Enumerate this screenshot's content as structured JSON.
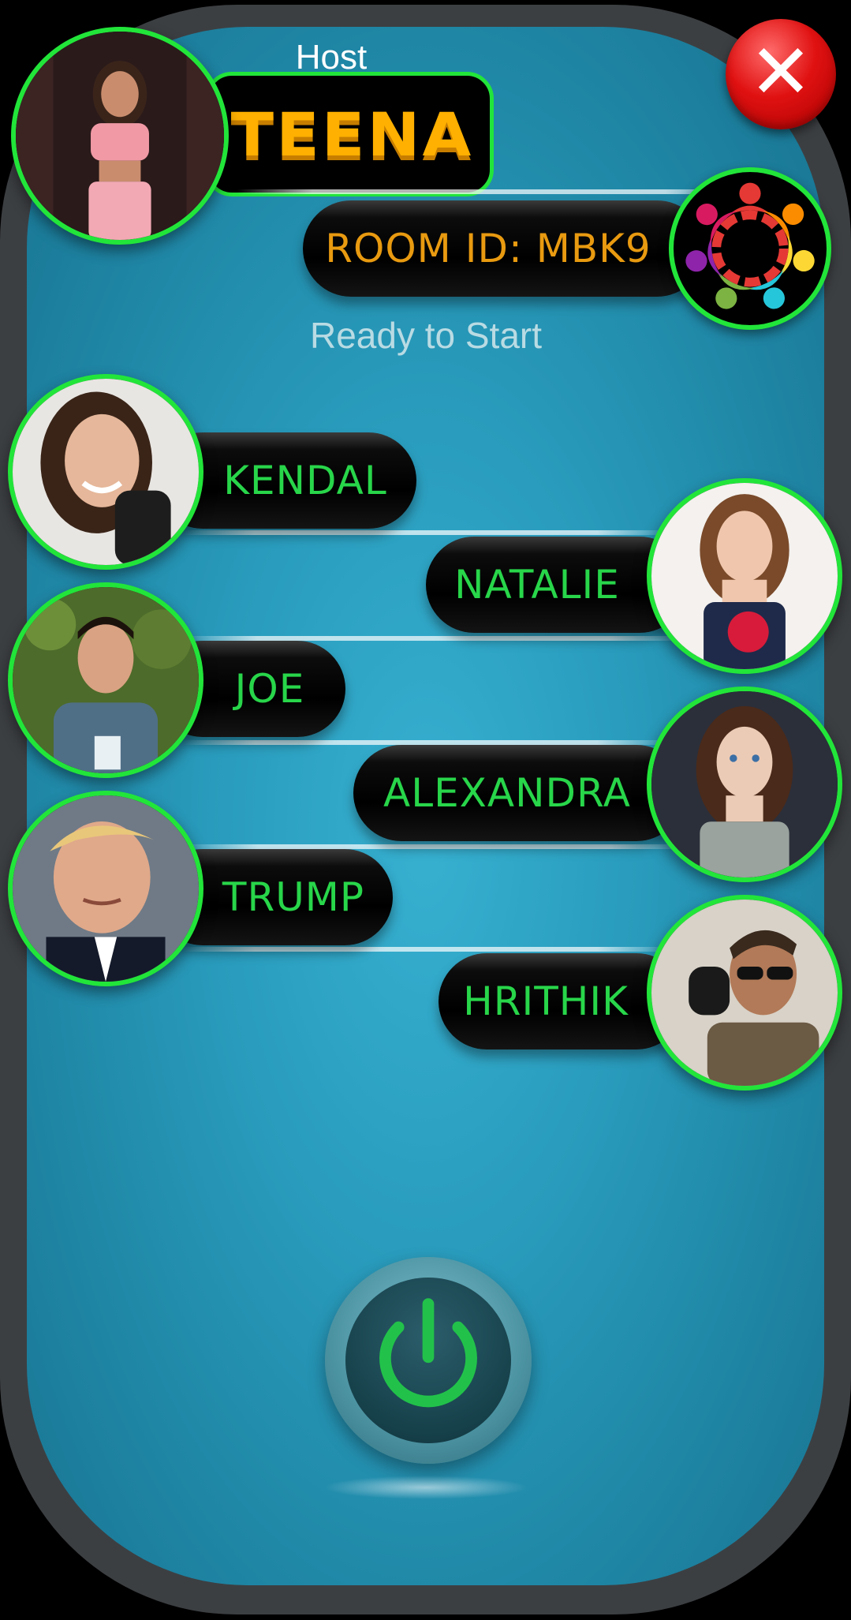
{
  "header": {
    "host_label": "Host",
    "host_name": "TEENA",
    "close_icon": "close-icon"
  },
  "room": {
    "label": "ROOM ID: MBK9",
    "logo_icon": "team-circle-icon"
  },
  "status": "Ready to Start",
  "players": [
    {
      "name": "KENDAL",
      "side": "left"
    },
    {
      "name": "NATALIE",
      "side": "right"
    },
    {
      "name": "JOE",
      "side": "left"
    },
    {
      "name": "ALEXANDRA",
      "side": "right"
    },
    {
      "name": "TRUMP",
      "side": "left"
    },
    {
      "name": "HRITHIK",
      "side": "right"
    }
  ],
  "start_button": {
    "icon": "power-icon"
  },
  "colors": {
    "accent_green": "#22e53a",
    "name_green": "#28d64a",
    "room_orange": "#e89a10",
    "host_name_orange": "#ffb000",
    "panel_blue": "#2a9dbe",
    "close_red": "#e01111"
  }
}
